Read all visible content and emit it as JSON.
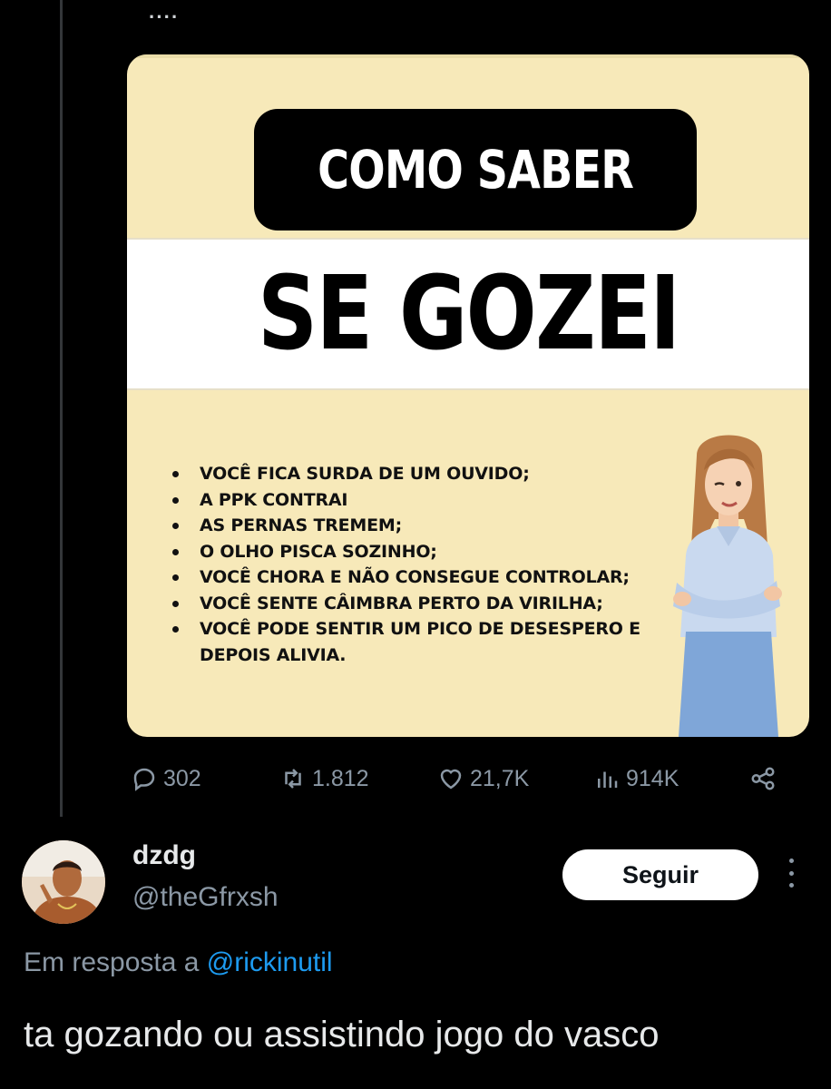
{
  "thread": {
    "ellipsis": "····"
  },
  "media": {
    "title_line1": "COMO SABER",
    "title_line2": "SE GOZEI",
    "bullets": [
      "VOCÊ FICA SURDA DE UM OUVIDO;",
      "A PPK CONTRAI",
      "AS PERNAS TREMEM;",
      "O OLHO PISCA SOZINHO;",
      "VOCÊ CHORA E NÃO CONSEGUE CONTROLAR;",
      "VOCÊ SENTE CÂIMBRA PERTO DA VIRILHA;",
      "VOCÊ PODE SENTIR UM PICO DE DESESPERO E DEPOIS ALIVIA."
    ],
    "background_color": "#f7e9b9"
  },
  "actions": {
    "replies": "302",
    "reposts": "1.812",
    "likes": "21,7K",
    "views": "914K"
  },
  "reply": {
    "display_name": "dzdg",
    "handle": "@theGfrxsh",
    "follow_label": "Seguir",
    "reply_prefix": "Em resposta a",
    "reply_mention": "@rickinutil",
    "text": "ta gozando ou assistindo jogo do vasco"
  },
  "colors": {
    "background": "#000000",
    "muted_text": "#8b98a5",
    "link": "#1d9bf0",
    "primary_text": "#e7e9ea"
  }
}
